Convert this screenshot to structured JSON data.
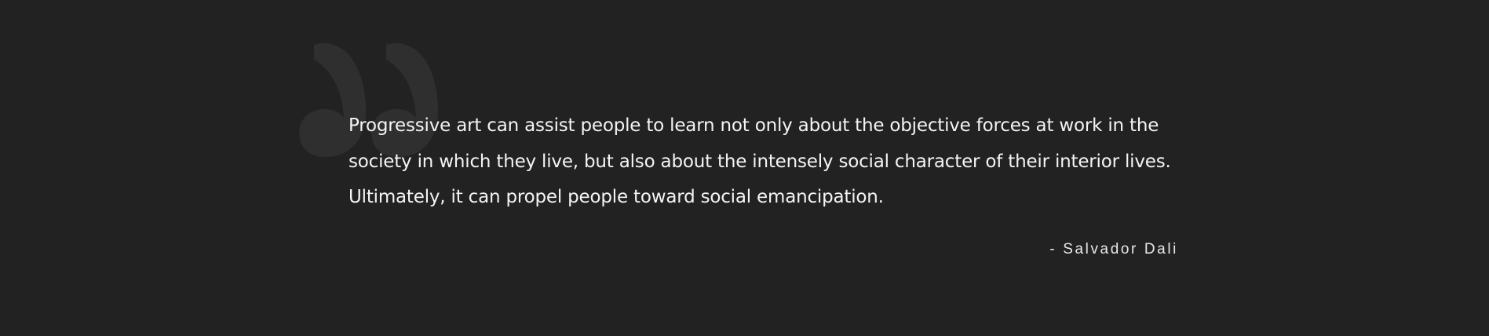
{
  "quote": {
    "icon": "quote-mark-icon",
    "text": "Progressive art can assist people to learn not only about the objective forces at work in the\nsociety in which they live, but also about the intensely social character of their interior lives.\nUltimately, it can propel people toward social emancipation.",
    "author": "- Salvador Dali"
  },
  "colors": {
    "background": "#222222",
    "quote_mark": "#2f2f2f",
    "text": "#f4f4f4"
  }
}
